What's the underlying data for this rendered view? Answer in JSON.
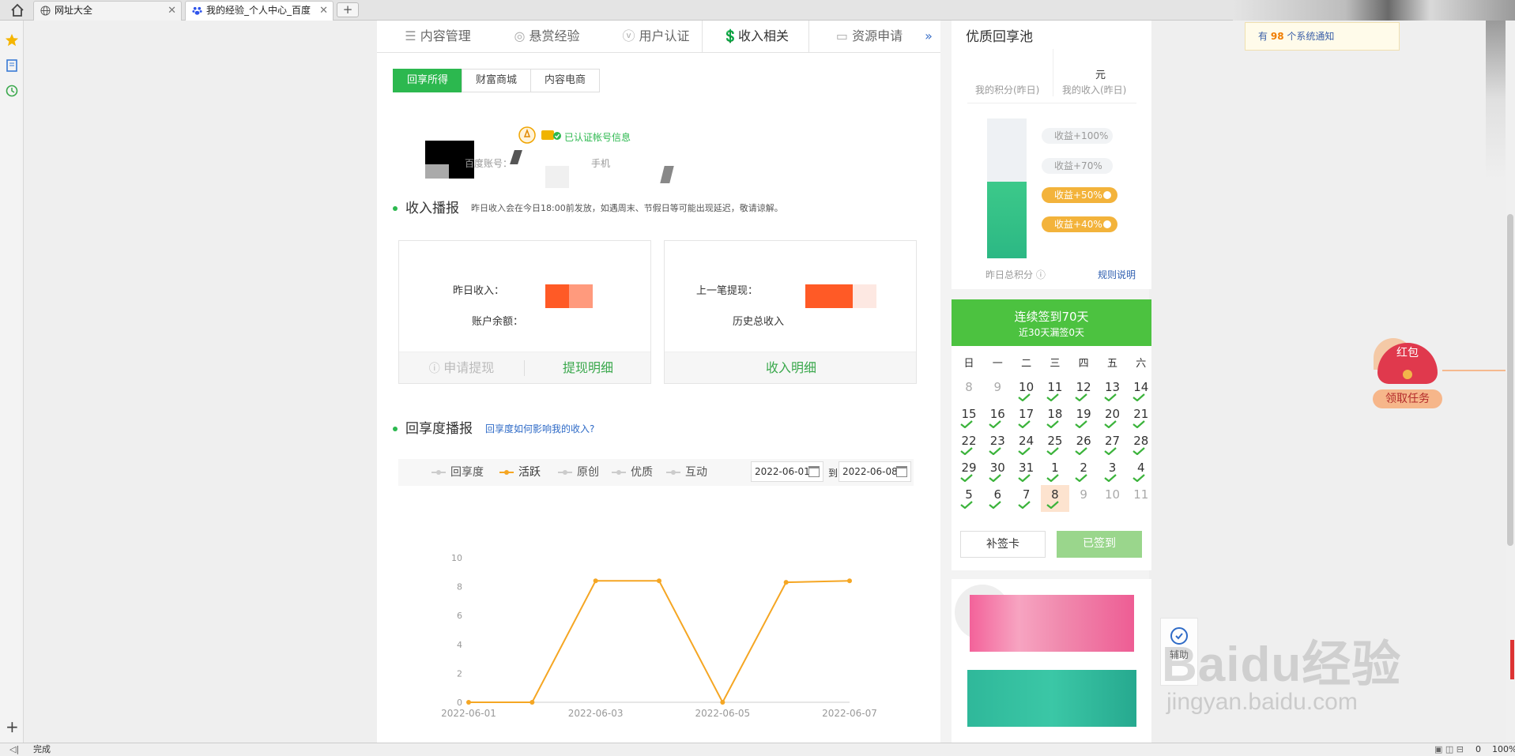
{
  "browser": {
    "tabs": [
      {
        "title": "网址大全",
        "close": "✕"
      },
      {
        "title": "我的经验_个人中心_百度",
        "close": "✕"
      }
    ],
    "new_tab": "+",
    "status": "完成",
    "zoom": "100%",
    "counter": "0"
  },
  "notice": {
    "prefix": "有",
    "count": "98",
    "suffix": "个系统通知"
  },
  "nav": {
    "tabs": [
      "内容管理",
      "悬赏经验",
      "用户认证",
      "收入相关",
      "资源申请"
    ],
    "more": "»"
  },
  "subtabs": [
    "回享所得",
    "财富商城",
    "内容电商"
  ],
  "account": {
    "verified": "已认证帐号信息",
    "baidu_label": "百度账号：",
    "phone_label": "手机"
  },
  "income_section": {
    "title": "收入播报",
    "note": "昨日收入会在今日18:00前发放，如遇周末、节假日等可能出现延迟，敬请谅解。",
    "yesterday_label": "昨日收入：",
    "balance_label": "账户余额：",
    "last_withdraw_label": "上一笔提现：",
    "history_label": "历史总收入",
    "apply_withdraw": "申请提现",
    "withdraw_detail": "提现明细",
    "income_detail": "收入明细"
  },
  "share_section": {
    "title": "回享度播报",
    "link": "回享度如何影响我的收入?",
    "legend": [
      "回享度",
      "活跃",
      "原创",
      "优质",
      "互动"
    ],
    "date_from": "2022-06-01",
    "to": "到",
    "date_to": "2022-06-08"
  },
  "chart_data": {
    "type": "line",
    "x": [
      "2022-06-01",
      "2022-06-02",
      "2022-06-03",
      "2022-06-04",
      "2022-06-05",
      "2022-06-06",
      "2022-06-07"
    ],
    "xticks": [
      "2022-06-01",
      "2022-06-03",
      "2022-06-05",
      "2022-06-07"
    ],
    "series": [
      {
        "name": "活跃",
        "values": [
          0,
          0,
          8.4,
          8.4,
          0,
          8.3,
          8.4
        ],
        "color": "#f5a623"
      }
    ],
    "ylim": [
      0,
      10
    ],
    "yticks": [
      "0",
      "2",
      "4",
      "6",
      "8",
      "10"
    ]
  },
  "quality": {
    "title": "优质回享池",
    "points_label": "我的积分(昨日)",
    "income_label": "我的收入(昨日)",
    "income_unit": "元",
    "levels": [
      "收益+100%",
      "收益+70%",
      "收益+50%",
      "收益+40%"
    ],
    "fill": 0.55,
    "total_label": "昨日总积分",
    "rules": "规则说明"
  },
  "signin": {
    "title": "连续签到70天",
    "sub": "近30天漏签0天",
    "weekdays": [
      "日",
      "一",
      "二",
      "三",
      "四",
      "五",
      "六"
    ],
    "days": [
      {
        "d": "8",
        "dim": true,
        "chk": false
      },
      {
        "d": "9",
        "dim": true,
        "chk": false
      },
      {
        "d": "10",
        "chk": true
      },
      {
        "d": "11",
        "chk": true
      },
      {
        "d": "12",
        "chk": true
      },
      {
        "d": "13",
        "chk": true
      },
      {
        "d": "14",
        "chk": true
      },
      {
        "d": "15",
        "chk": true
      },
      {
        "d": "16",
        "chk": true
      },
      {
        "d": "17",
        "chk": true
      },
      {
        "d": "18",
        "chk": true
      },
      {
        "d": "19",
        "chk": true
      },
      {
        "d": "20",
        "chk": true
      },
      {
        "d": "21",
        "chk": true
      },
      {
        "d": "22",
        "chk": true
      },
      {
        "d": "23",
        "chk": true
      },
      {
        "d": "24",
        "chk": true
      },
      {
        "d": "25",
        "chk": true
      },
      {
        "d": "26",
        "chk": true
      },
      {
        "d": "27",
        "chk": true
      },
      {
        "d": "28",
        "chk": true
      },
      {
        "d": "29",
        "chk": true
      },
      {
        "d": "30",
        "chk": true
      },
      {
        "d": "31",
        "chk": true
      },
      {
        "d": "1",
        "chk": true
      },
      {
        "d": "2",
        "chk": true
      },
      {
        "d": "3",
        "chk": true
      },
      {
        "d": "4",
        "chk": true
      },
      {
        "d": "5",
        "chk": true
      },
      {
        "d": "6",
        "chk": true
      },
      {
        "d": "7",
        "chk": true
      },
      {
        "d": "8",
        "chk": true,
        "today": true
      },
      {
        "d": "9",
        "dim": true,
        "chk": false
      },
      {
        "d": "10",
        "dim": true,
        "chk": false
      },
      {
        "d": "11",
        "dim": true,
        "chk": false
      }
    ],
    "makeup": "补签卡",
    "signed": "已签到"
  },
  "redpacket": {
    "title": "红包",
    "task": "领取任务"
  },
  "helper": {
    "label": "辅助"
  },
  "watermark": {
    "brand": "Baidu经验",
    "url": "jingyan.baidu.com"
  }
}
